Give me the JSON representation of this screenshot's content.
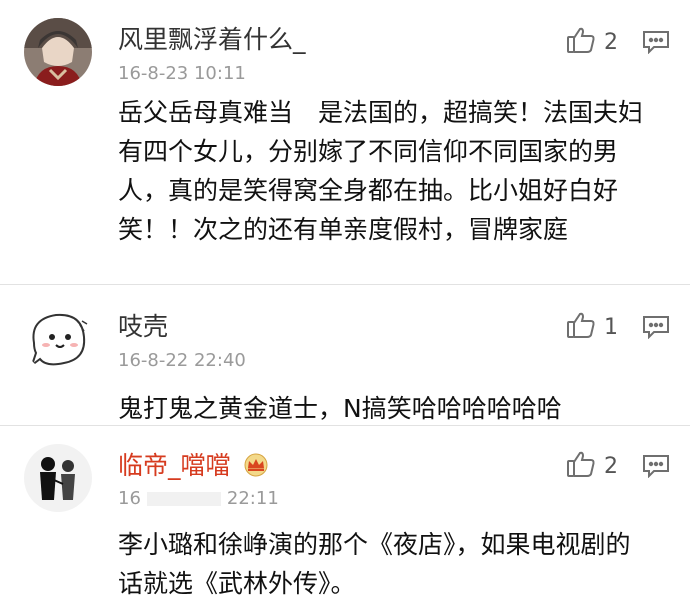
{
  "comments": [
    {
      "username": "风里飘浮着什么_",
      "timestamp": "16-8-23 10:11",
      "content": "岳父岳母真难当　是法国的，超搞笑！法国夫妇有四个女儿，分别嫁了不同信仰不同国家的男人，真的是笑得窝全身都在抽。比小姐好白好笑！！次之的还有单亲度假村，冒牌家庭",
      "likes": "2"
    },
    {
      "username": "吱壳",
      "timestamp": "16-8-22 22:40",
      "content": "鬼打鬼之黄金道士，N搞笑哈哈哈哈哈哈",
      "likes": "1"
    },
    {
      "username": "临帝_噹噹",
      "timestamp_left": "16",
      "timestamp_right": "22:11",
      "content": "李小璐和徐峥演的那个《夜店》，如果电视剧的话就选《武林外传》。",
      "likes": "2"
    }
  ],
  "icons": {
    "like": "thumbs-up-icon",
    "reply": "comment-icon",
    "badge": "crown-icon"
  },
  "colors": {
    "vip_name": "#d63b1f",
    "meta": "#9a9a9a",
    "divider": "#e2e2e2"
  }
}
